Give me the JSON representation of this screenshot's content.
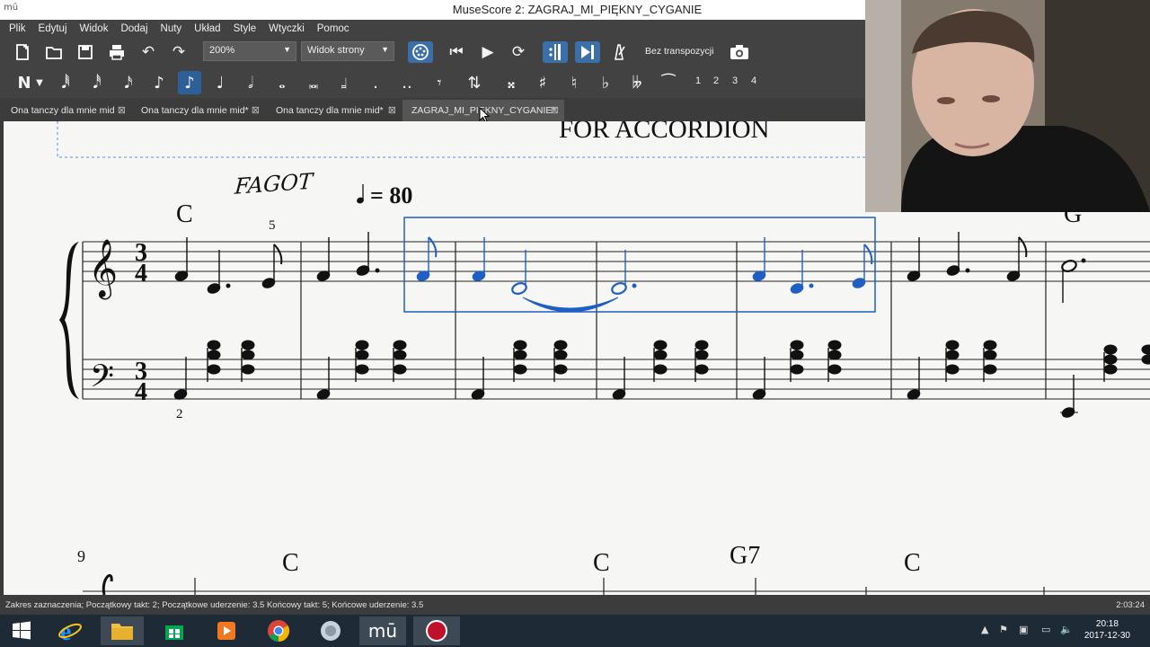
{
  "window": {
    "title": "MuseScore 2: ZAGRAJ_MI_PIĘKNY_CYGANIE",
    "app_icon": "mū"
  },
  "menu": [
    "Plik",
    "Edytuj",
    "Widok",
    "Dodaj",
    "Nuty",
    "Układ",
    "Style",
    "Wtyczki",
    "Pomoc"
  ],
  "toolbar": {
    "zoom": "200%",
    "view_mode": "Widok strony",
    "transposition": "Bez transpozycji",
    "voices": [
      "1",
      "2",
      "3",
      "4"
    ]
  },
  "tabs": [
    {
      "label": "Ona tanczy dla mnie mid",
      "active": false
    },
    {
      "label": "Ona tanczy dla mnie mid*",
      "active": false
    },
    {
      "label": "Ona tanczy dla mnie mid*",
      "active": false
    },
    {
      "label": "ZAGRAJ_MI_PIĘKNY_CYGANIE*",
      "active": true
    }
  ],
  "score": {
    "subtitle": "FOR ACCORDION",
    "instrument_text": "FAGOT",
    "tempo": "= 80",
    "time_signature": [
      "3",
      "4"
    ],
    "chord_symbols_system1": [
      "C",
      "G"
    ],
    "chord_symbols_system2": [
      "C",
      "C",
      "G7",
      "C"
    ],
    "measure_number_system2": "9",
    "fingering_treble": "5",
    "fingering_bass": "2",
    "selection_color": "#1f5fc4",
    "note_color": "#111111"
  },
  "status": {
    "selection": "Zakres zaznaczenia; Początkowy takt: 2; Początkowe uderzenie: 3.5 Końcowy takt: 5; Końcowe uderzenie: 3.5",
    "time": "2:03:24"
  },
  "taskbar": {
    "clock_time": "20:18",
    "clock_date": "2017-12-30"
  }
}
